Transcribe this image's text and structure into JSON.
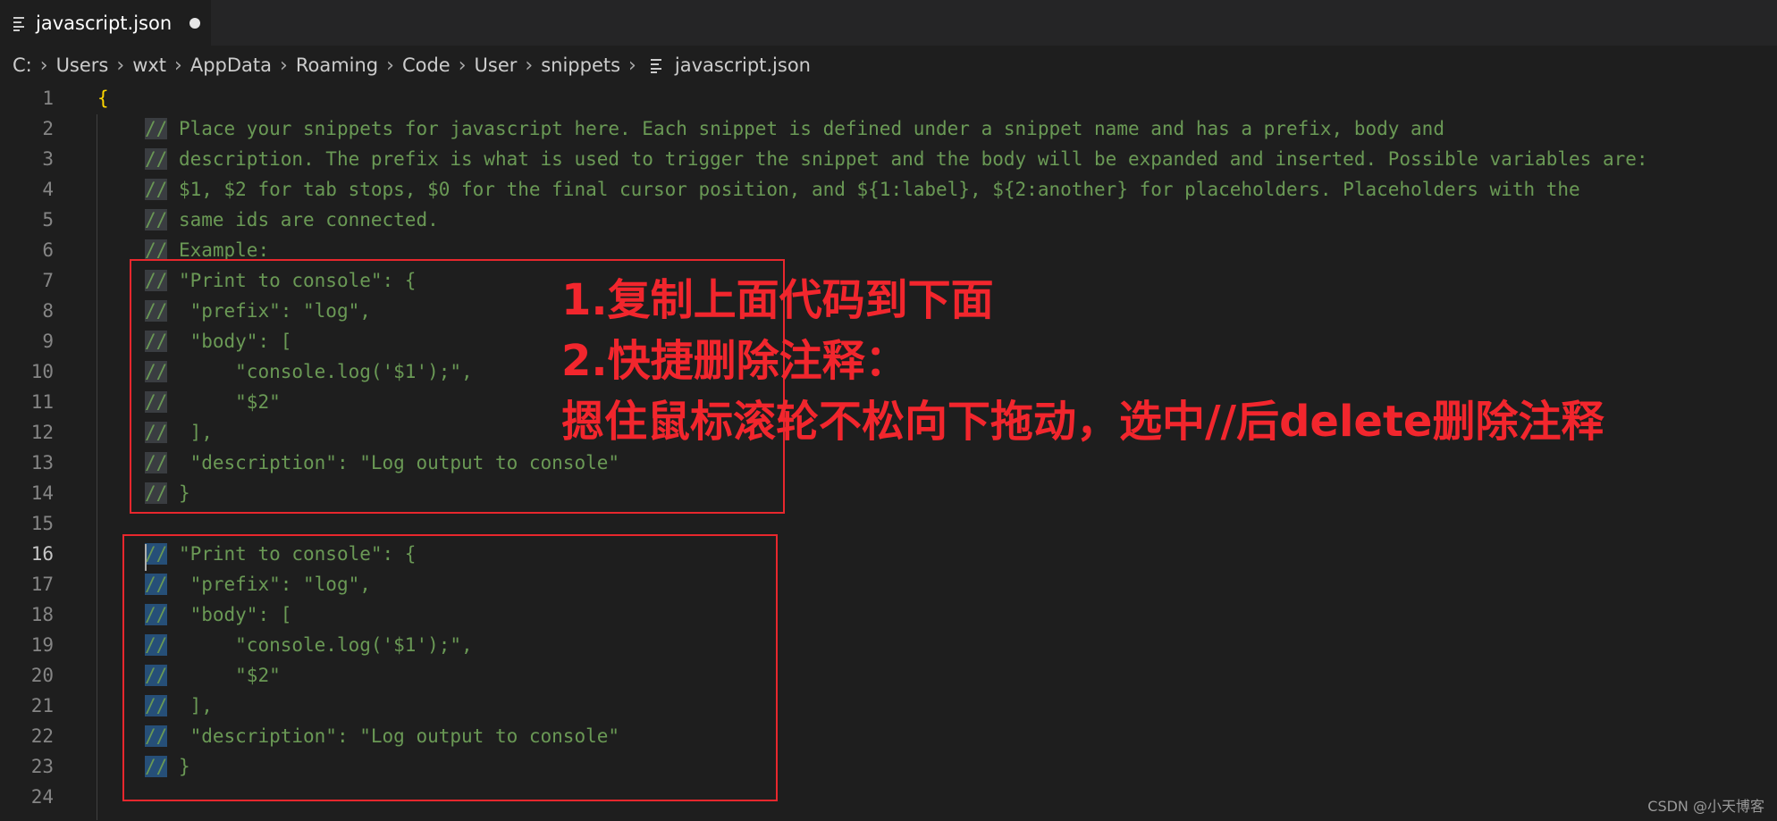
{
  "tab": {
    "title": "javascript.json"
  },
  "breadcrumb": [
    "C:",
    "Users",
    "wxt",
    "AppData",
    "Roaming",
    "Code",
    "User",
    "snippets",
    "javascript.json"
  ],
  "lines": [
    {
      "n": "1",
      "text": "{",
      "kind": "brace"
    },
    {
      "n": "2",
      "text": "// Place your snippets for javascript here. Each snippet is defined under a snippet name and has a prefix, body and",
      "kind": "comment"
    },
    {
      "n": "3",
      "text": "// description. The prefix is what is used to trigger the snippet and the body will be expanded and inserted. Possible variables are:",
      "kind": "comment"
    },
    {
      "n": "4",
      "text": "// $1, $2 for tab stops, $0 for the final cursor position, and ${1:label}, ${2:another} for placeholders. Placeholders with the",
      "kind": "comment"
    },
    {
      "n": "5",
      "text": "// same ids are connected.",
      "kind": "comment"
    },
    {
      "n": "6",
      "text": "// Example:",
      "kind": "comment"
    },
    {
      "n": "7",
      "text": "// \"Print to console\": {",
      "kind": "comment"
    },
    {
      "n": "8",
      "text": "//  \"prefix\": \"log\",",
      "kind": "comment"
    },
    {
      "n": "9",
      "text": "//  \"body\": [",
      "kind": "comment"
    },
    {
      "n": "10",
      "text": "//      \"console.log('$1');\",",
      "kind": "comment"
    },
    {
      "n": "11",
      "text": "//      \"$2\"",
      "kind": "comment"
    },
    {
      "n": "12",
      "text": "//  ],",
      "kind": "comment"
    },
    {
      "n": "13",
      "text": "//  \"description\": \"Log output to console\"",
      "kind": "comment"
    },
    {
      "n": "14",
      "text": "// }",
      "kind": "comment"
    },
    {
      "n": "15",
      "text": "",
      "kind": "empty"
    },
    {
      "n": "16",
      "text": "// \"Print to console\": {",
      "kind": "comment"
    },
    {
      "n": "17",
      "text": "//  \"prefix\": \"log\",",
      "kind": "comment"
    },
    {
      "n": "18",
      "text": "//  \"body\": [",
      "kind": "comment"
    },
    {
      "n": "19",
      "text": "//      \"console.log('$1');\",",
      "kind": "comment"
    },
    {
      "n": "20",
      "text": "//      \"$2\"",
      "kind": "comment"
    },
    {
      "n": "21",
      "text": "//  ],",
      "kind": "comment"
    },
    {
      "n": "22",
      "text": "//  \"description\": \"Log output to console\"",
      "kind": "comment"
    },
    {
      "n": "23",
      "text": "// }",
      "kind": "comment"
    },
    {
      "n": "24",
      "text": "",
      "kind": "empty"
    }
  ],
  "active_line": "16",
  "annotations": [
    "1.复制上面代码到下面",
    "2.快捷删除注释：",
    "摁住鼠标滚轮不松向下拖动，选中//后delete删除注释"
  ],
  "watermark": "CSDN @小天博客",
  "colors": {
    "comment": "#6a9955",
    "brace": "#ffd700",
    "annotation": "#e8272d",
    "selection": "#264f78"
  }
}
